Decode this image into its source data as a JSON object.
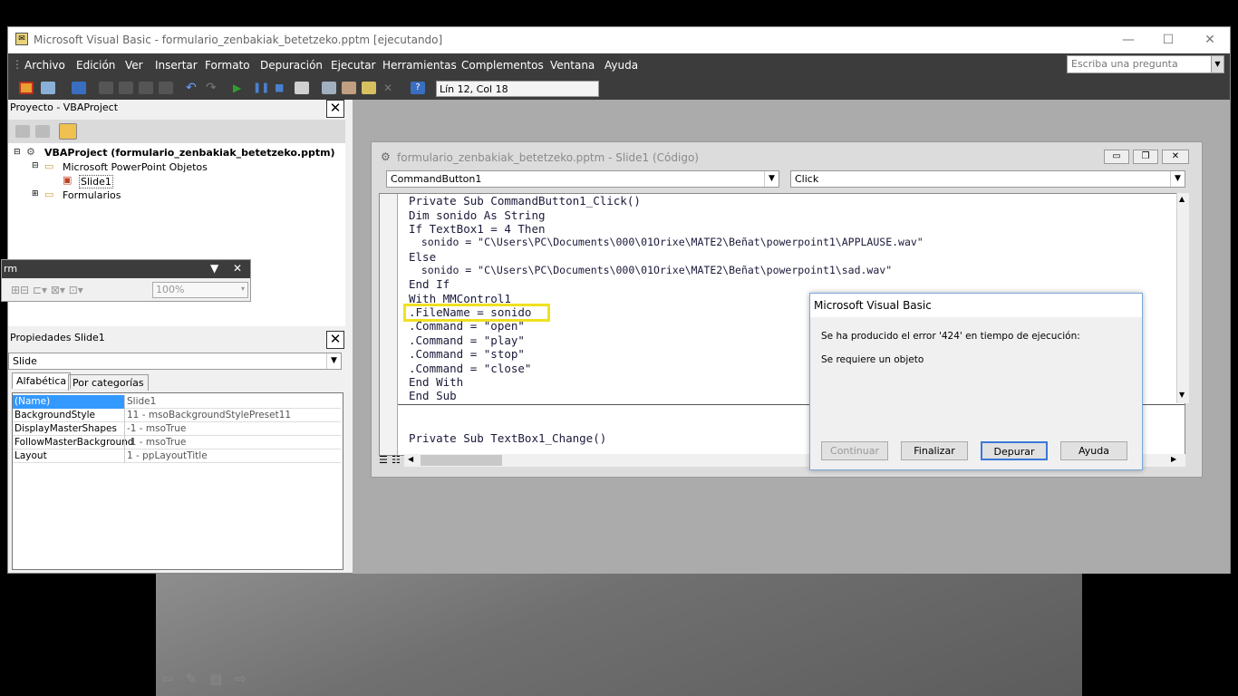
{
  "window": {
    "title": "Microsoft Visual Basic - formulario_zenbakiak_betetzeko.pptm [ejecutando]",
    "controls": {
      "minimize": "—",
      "maximize": "☐",
      "close": "✕"
    }
  },
  "menu": {
    "items": [
      "Archivo",
      "Edición",
      "Ver",
      "Insertar",
      "Formato",
      "Depuración",
      "Ejecutar",
      "Herramientas",
      "Complementos",
      "Ventana",
      "Ayuda"
    ],
    "ask_placeholder": "Escriba una pregunta"
  },
  "toolbar": {
    "position": "Lín 12, Col 18"
  },
  "project": {
    "title": "Proyecto - VBAProject",
    "root": "VBAProject (formulario_zenbakiak_betetzeko.pptm)",
    "folder1": "Microsoft PowerPoint Objetos",
    "slide": "Slide1",
    "folder2": "Formularios"
  },
  "floatbar": {
    "title": "rm",
    "zoom": "100%"
  },
  "properties": {
    "title": "Propiedades Slide1",
    "object": "Slide",
    "tab1": "Alfabética",
    "tab2": "Por categorías",
    "rows": [
      {
        "k": "(Name)",
        "v": "Slide1"
      },
      {
        "k": "BackgroundStyle",
        "v": "11 - msoBackgroundStylePreset11"
      },
      {
        "k": "DisplayMasterShapes",
        "v": "-1 - msoTrue"
      },
      {
        "k": "FollowMasterBackground",
        "v": "-1 - msoTrue"
      },
      {
        "k": "Layout",
        "v": "1 - ppLayoutTitle"
      }
    ]
  },
  "code_window": {
    "title": "formulario_zenbakiak_betetzeko.pptm - Slide1 (Código)",
    "object": "CommandButton1",
    "procedure": "Click",
    "lines": [
      "Private Sub CommandButton1_Click()",
      "Dim sonido As String",
      "If TextBox1 = 4 Then",
      "  sonido = \"C\\Users\\PC\\Documents\\000\\01Orixe\\MATE2\\Beñat\\powerpoint1\\APPLAUSE.wav\"",
      "Else",
      "  sonido = \"C\\Users\\PC\\Documents\\000\\01Orixe\\MATE2\\Beñat\\powerpoint1\\sad.wav\"",
      "End If",
      "With MMControl1",
      ".FileName = sonido",
      ".Command = \"open\"",
      ".Command = \"play\"",
      ".Command = \"stop\"",
      ".Command = \"close\"",
      "End With",
      "End Sub"
    ],
    "line2": "Private Sub TextBox1_Change()"
  },
  "dialog": {
    "title": "Microsoft Visual Basic",
    "message1": "Se ha producido el error '424' en tiempo de ejecución:",
    "message2": "Se requiere un objeto",
    "buttons": [
      "Continuar",
      "Finalizar",
      "Depurar",
      "Ayuda"
    ]
  }
}
